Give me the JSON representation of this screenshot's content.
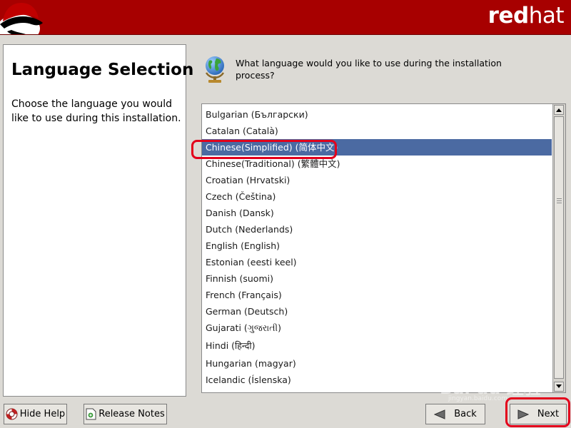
{
  "banner": {
    "brand_bold": "red",
    "brand_light": "hat",
    "logo_icon": "shadowman-logo-icon",
    "color": "#a70000"
  },
  "help": {
    "title": "Language Selection",
    "text": "Choose the language you would like to use during this installation."
  },
  "question": {
    "icon": "globe-icon",
    "text": "What language would you like to use during the installation process?"
  },
  "languages": {
    "selected_index": 2,
    "selected_color": "#4b6aa2",
    "items": [
      "Bulgarian (Български)",
      "Catalan (Català)",
      "Chinese(Simplified) (简体中文)",
      "Chinese(Traditional) (繁體中文)",
      "Croatian (Hrvatski)",
      "Czech (Čeština)",
      "Danish (Dansk)",
      "Dutch (Nederlands)",
      "English (English)",
      "Estonian (eesti keel)",
      "Finnish (suomi)",
      "French (Français)",
      "German (Deutsch)",
      "Gujarati (ગુજરાતી)",
      "Hindi (हिन्दी)",
      "Hungarian (magyar)",
      "Icelandic (Íslenska)"
    ]
  },
  "buttons": {
    "hide_help": "Hide Help",
    "release_notes": "Release Notes",
    "back": "Back",
    "next": "Next"
  },
  "annotation": {
    "color": "#e3001b"
  },
  "watermark": {
    "text": "Bai du 经验",
    "sub": "jingyan.baidu.com"
  }
}
